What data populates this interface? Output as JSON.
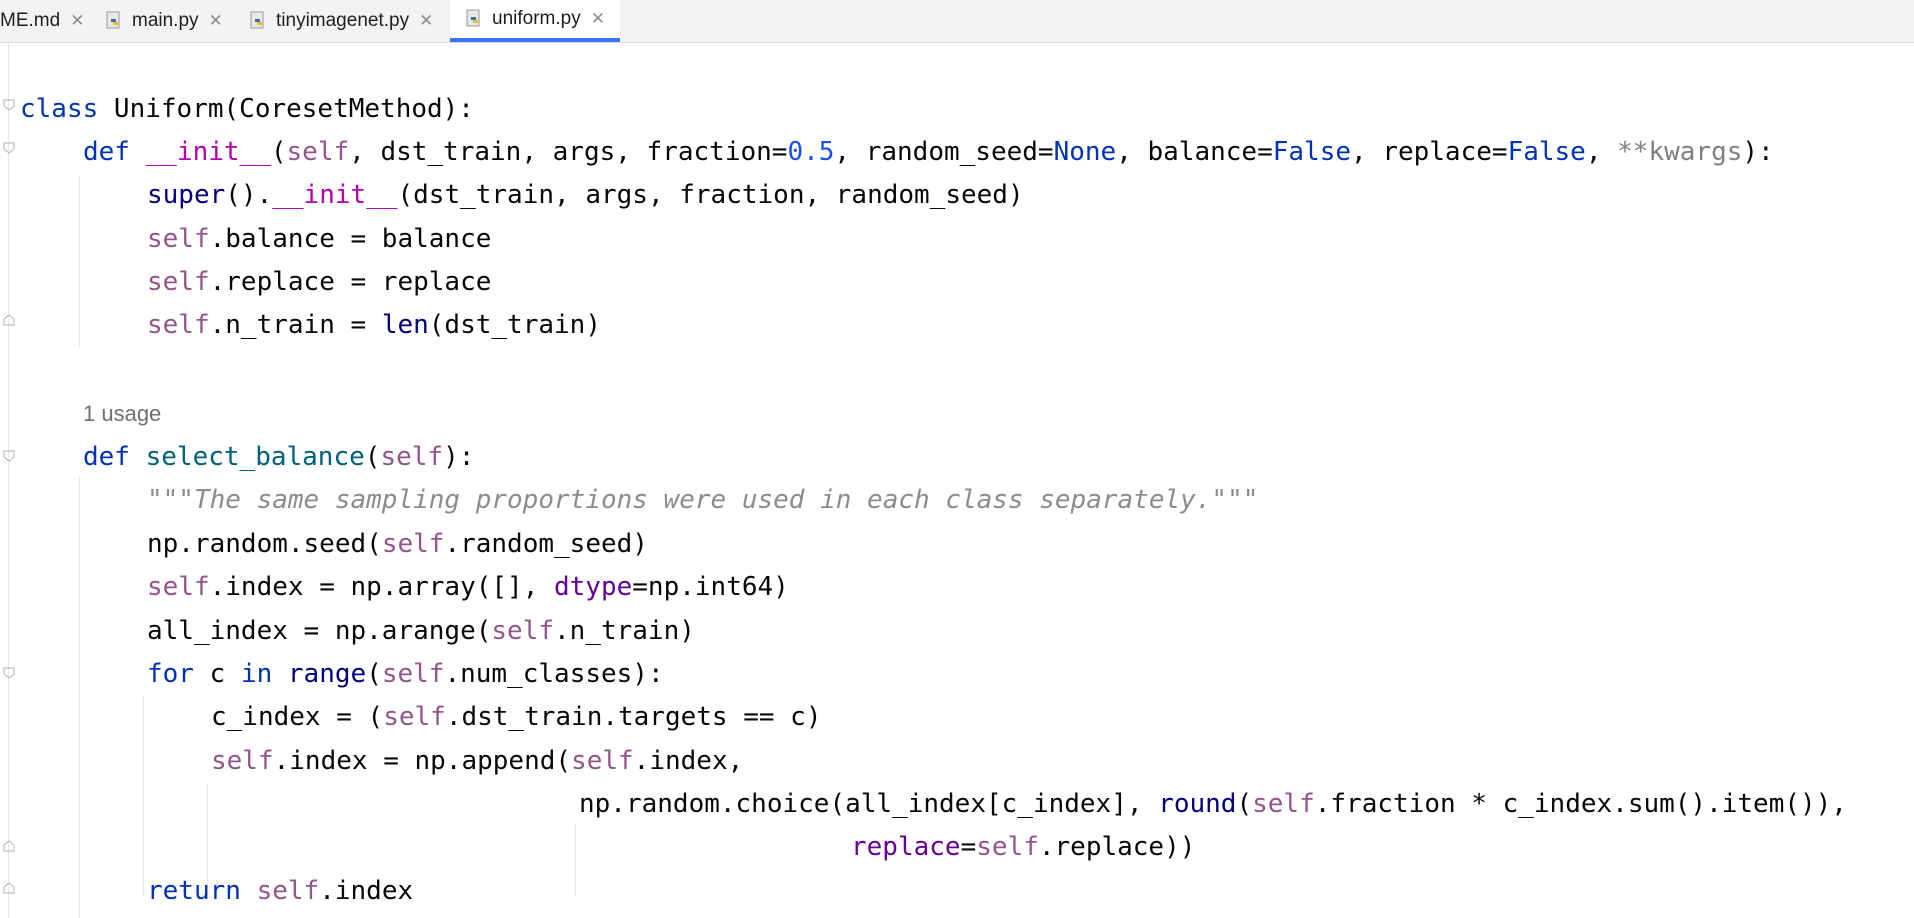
{
  "tabs": [
    {
      "label": "ME.md",
      "active": false
    },
    {
      "label": "main.py",
      "active": false
    },
    {
      "label": "tinyimagenet.py",
      "active": false
    },
    {
      "label": "uniform.py",
      "active": true
    }
  ],
  "tab_close_glyph": "✕",
  "colors": {
    "keyword": "#0033b3",
    "self": "#94558d",
    "number": "#1750eb",
    "dunder": "#b200b2",
    "function": "#00627a",
    "builtin": "#000080",
    "param": "#660099",
    "docstring": "#8c8c8c",
    "active_tab_underline": "#3574f0"
  },
  "code": {
    "class_kw": "class",
    "class_rest": " Uniform(CoresetMethod):",
    "def_kw": "def",
    "init_name": "__init__",
    "init_open": "(",
    "self": "self",
    "init_args_a": ", dst_train, args, fraction=",
    "fraction_default": "0.5",
    "init_args_b": ", random_seed=",
    "none_kw": "None",
    "init_args_c": ", balance=",
    "false_kw": "False",
    "init_args_d": ", replace=",
    "init_args_e": ", ",
    "kwargs": "**kwargs",
    "init_close": "):",
    "super_kw": "super",
    "super_rest_a": "().",
    "super_rest_b": "(dst_train, args, fraction, random_seed)",
    "balance_rest": ".balance = balance",
    "replace_rest": ".replace = replace",
    "ntrain_rest": ".n_train = ",
    "len_kw": "len",
    "ntrain_tail": "(dst_train)",
    "usage_hint": "1 usage",
    "select_name": "select_balance",
    "open_paren": "(",
    "close_paren_colon": "):",
    "docstring": "\"\"\"The same sampling proportions were used in each class separately.\"\"\"",
    "seed_a": "np.random.seed(",
    "seed_b": ".random_seed)",
    "index_a": ".index = np.array([], ",
    "dtype_kw": "dtype",
    "index_b": "=np.int64)",
    "allidx_a": "all_index = np.arange(",
    "allidx_b": ".n_train)",
    "for_kw": "for",
    "for_mid": " c ",
    "in_kw": "in",
    "space": " ",
    "range_kw": "range",
    "for_tail": ".num_classes):",
    "cidx_a": "c_index = (",
    "cidx_b": ".dst_train.targets == c)",
    "append_a": ".index = np.append(",
    "append_b": ".index,",
    "choice_a": "np.random.choice(all_index[c_index], ",
    "round_kw": "round",
    "choice_b": ".fraction * c_index.sum().item()),",
    "replace_kw": "replace",
    "eq": "=",
    "replace_tail": ".replace))",
    "return_kw": "return",
    "return_tail": ".index"
  }
}
